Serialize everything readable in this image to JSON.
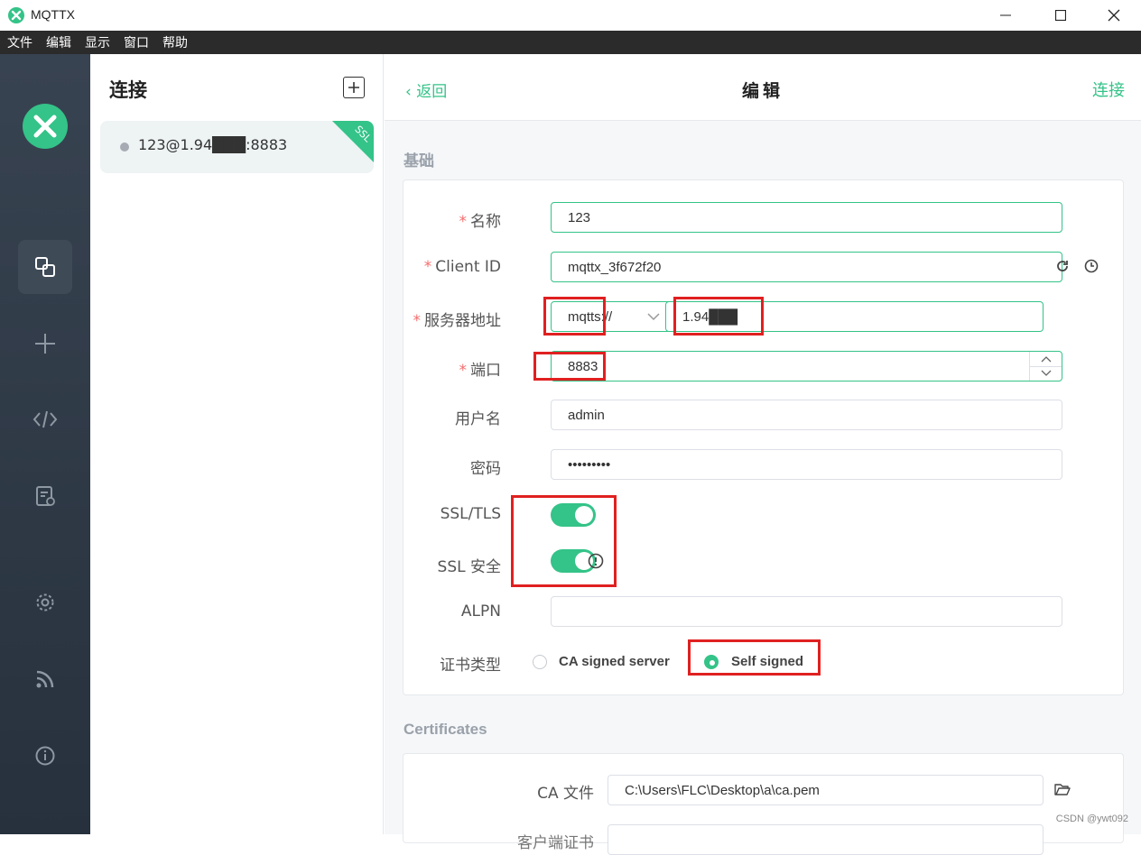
{
  "window": {
    "title": "MQTTX"
  },
  "menu": [
    "文件",
    "编辑",
    "显示",
    "窗口",
    "帮助"
  ],
  "connections": {
    "title": "连接",
    "items": [
      {
        "name": "123@1.94███:8883",
        "badge": "SSL"
      }
    ]
  },
  "header": {
    "back": "返回",
    "title": "编辑",
    "connect": "连接"
  },
  "basic": {
    "section": "基础",
    "name_label": "名称",
    "name_value": "123",
    "clientid_label": "Client ID",
    "clientid_value": "mqttx_3f672f20",
    "host_label": "服务器地址",
    "protocol_value": "mqtts://",
    "host_value": "1.94███",
    "port_label": "端口",
    "port_value": "8883",
    "username_label": "用户名",
    "username_value": "admin",
    "password_label": "密码",
    "password_value": "•••••••••",
    "ssl_label": "SSL/TLS",
    "ssl_secure_label": "SSL 安全",
    "alpn_label": "ALPN",
    "alpn_value": "",
    "cert_label": "证书类型",
    "cert_options": [
      "CA signed server",
      "Self signed"
    ]
  },
  "certificates": {
    "section": "Certificates",
    "ca_label": "CA 文件",
    "ca_value": "C:\\Users\\FLC\\Desktop\\a\\ca.pem",
    "next_label": "客户端证书"
  },
  "watermark": "CSDN @ywt092",
  "colors": {
    "accent": "#34c388",
    "annotation": "#e02020"
  }
}
